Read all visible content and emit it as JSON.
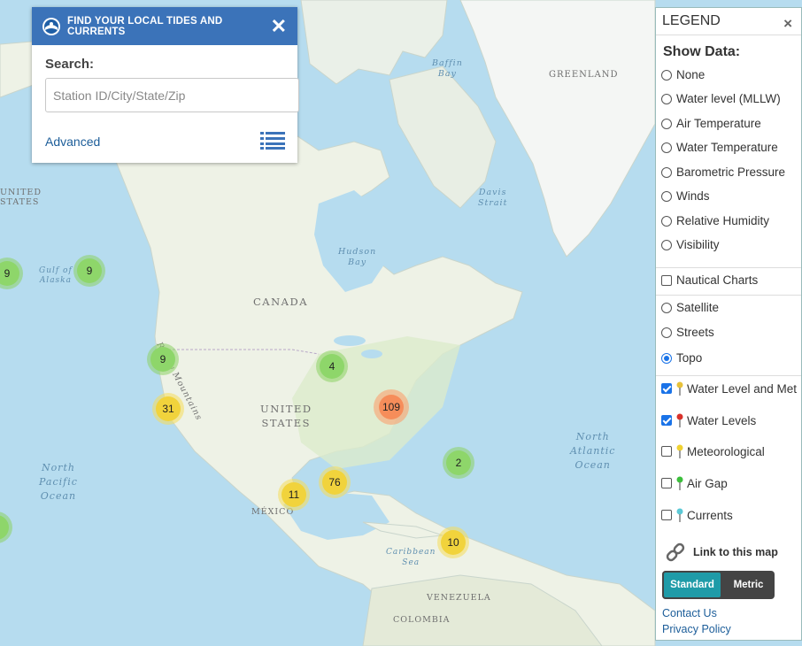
{
  "search_panel": {
    "title": "FIND YOUR LOCAL TIDES AND CURRENTS",
    "close_symbol": "✕",
    "search_label": "Search:",
    "search_placeholder": "Station ID/City/State/Zip",
    "advanced_label": "Advanced",
    "logo_icon": "noaa-logo-icon",
    "list_icon": "list-view-icon",
    "header_color": "#3b73b9"
  },
  "map": {
    "places": [
      "GREENLAND",
      "CANADA",
      "UNITED STATES",
      "MÉXICO",
      "VENEZUELA",
      "COLOMBIA",
      "UNITED STATES"
    ],
    "place_lines": {
      "edge_us": [
        "UNITED",
        "STATES"
      ],
      "us": [
        "UNITED",
        "STATES"
      ]
    },
    "water": {
      "baffin": [
        "Baffin",
        "Bay"
      ],
      "davis": [
        "Davis",
        "Strait"
      ],
      "hudson": [
        "Hudson",
        "Bay"
      ],
      "alaska": [
        "Gulf of",
        "Alaska"
      ],
      "n_pacific": [
        "North",
        "Pacific",
        "Ocean"
      ],
      "n_atlantic": [
        "North",
        "Atlantic",
        "Ocean"
      ],
      "caribbean": [
        "Caribbean",
        "Sea"
      ]
    },
    "mountains": "Rocky Mountains",
    "clusters": [
      {
        "id": "alaska-edge",
        "count": "9",
        "level": "green"
      },
      {
        "id": "se-alaska",
        "count": "9",
        "level": "green"
      },
      {
        "id": "pacific-nw",
        "count": "9",
        "level": "green"
      },
      {
        "id": "california",
        "count": "31",
        "level": "yellow"
      },
      {
        "id": "great-lakes",
        "count": "4",
        "level": "green"
      },
      {
        "id": "east-coast",
        "count": "109",
        "level": "orange"
      },
      {
        "id": "bermuda",
        "count": "2",
        "level": "green"
      },
      {
        "id": "texas",
        "count": "11",
        "level": "yellow"
      },
      {
        "id": "gulf",
        "count": "76",
        "level": "yellow"
      },
      {
        "id": "caribbean",
        "count": "10",
        "level": "yellow"
      }
    ]
  },
  "legend": {
    "title": "LEGEND",
    "close_symbol": "×",
    "show_data_label": "Show Data:",
    "data_options": [
      {
        "label": "None",
        "selected": false
      },
      {
        "label": "Water level (MLLW)",
        "selected": false
      },
      {
        "label": "Air Temperature",
        "selected": false
      },
      {
        "label": "Water Temperature",
        "selected": false
      },
      {
        "label": "Barometric Pressure",
        "selected": false
      },
      {
        "label": "Winds",
        "selected": false
      },
      {
        "label": "Relative Humidity",
        "selected": false
      },
      {
        "label": "Visibility",
        "selected": false
      }
    ],
    "nautical_charts": {
      "label": "Nautical Charts",
      "checked": false
    },
    "basemaps": [
      {
        "label": "Satellite",
        "selected": false
      },
      {
        "label": "Streets",
        "selected": false
      },
      {
        "label": "Topo",
        "selected": true
      }
    ],
    "layers": [
      {
        "label": "Water Level and Met",
        "checked": true,
        "pin_color": "#e8c23a",
        "pin_icon": "yellow-pin-icon"
      },
      {
        "label": "Water Levels",
        "checked": true,
        "pin_color": "#d9322b",
        "pin_icon": "red-pin-icon"
      },
      {
        "label": "Meteorological",
        "checked": false,
        "pin_color": "#f0d232",
        "pin_icon": "yellow-pin-icon"
      },
      {
        "label": "Air Gap",
        "checked": false,
        "pin_color": "#3cbf3c",
        "pin_icon": "green-pin-icon"
      },
      {
        "label": "Currents",
        "checked": false,
        "pin_color": "#5cc9d6",
        "pin_icon": "cyan-pin-icon"
      }
    ],
    "link_label": "Link to this map",
    "link_icon": "chain-link-icon",
    "units": {
      "standard": "Standard",
      "metric": "Metric",
      "active": "standard"
    },
    "contact_label": "Contact Us",
    "privacy_label": "Privacy Policy"
  }
}
